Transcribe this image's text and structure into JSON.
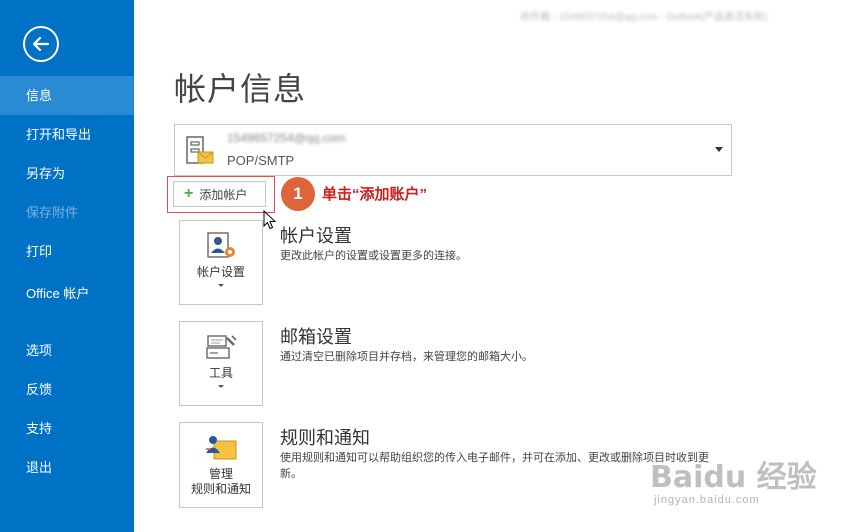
{
  "window_title": "收件箱 - 1549657254@qq.com - Outlook(产品激活失败)",
  "sidebar": {
    "items": [
      {
        "label": "信息",
        "state": "active"
      },
      {
        "label": "打开和导出",
        "state": "normal"
      },
      {
        "label": "另存为",
        "state": "normal"
      },
      {
        "label": "保存附件",
        "state": "disabled"
      },
      {
        "label": "打印",
        "state": "normal"
      },
      {
        "label": "Office 帐户",
        "state": "normal"
      },
      {
        "label": "选项",
        "state": "normal"
      },
      {
        "label": "反馈",
        "state": "normal"
      },
      {
        "label": "支持",
        "state": "normal"
      },
      {
        "label": "退出",
        "state": "normal"
      }
    ]
  },
  "main": {
    "title": "帐户信息",
    "account": {
      "email": "1549657254@qq.com",
      "type": "POP/SMTP"
    },
    "add_account_label": "添加帐户",
    "annotation": {
      "step": "1",
      "text": "单击“添加账户”"
    },
    "sections": [
      {
        "tile_label": "帐户设置",
        "title": "帐户设置",
        "description": "更改此帐户的设置或设置更多的连接。"
      },
      {
        "tile_label": "工具",
        "title": "邮箱设置",
        "description": "通过清空已删除项目并存档，来管理您的邮箱大小。"
      },
      {
        "tile_label": "管理\n规则和通知",
        "tile_label_1": "管理",
        "tile_label_2": "规则和通知",
        "title": "规则和通知",
        "description": "使用规则和通知可以帮助组织您的传入电子邮件，并可在添加、更改或删除项目时收到更新。"
      }
    ]
  },
  "watermark": {
    "logo": "Baidu 经验",
    "url": "jingyan.baidu.com"
  },
  "colors": {
    "sidebar": "#0072c6",
    "sidebar_active": "#2a8ad4",
    "annotation_circle": "#e0643a",
    "annotation_text": "#cc1f1f",
    "highlight_border": "#d9534f"
  }
}
